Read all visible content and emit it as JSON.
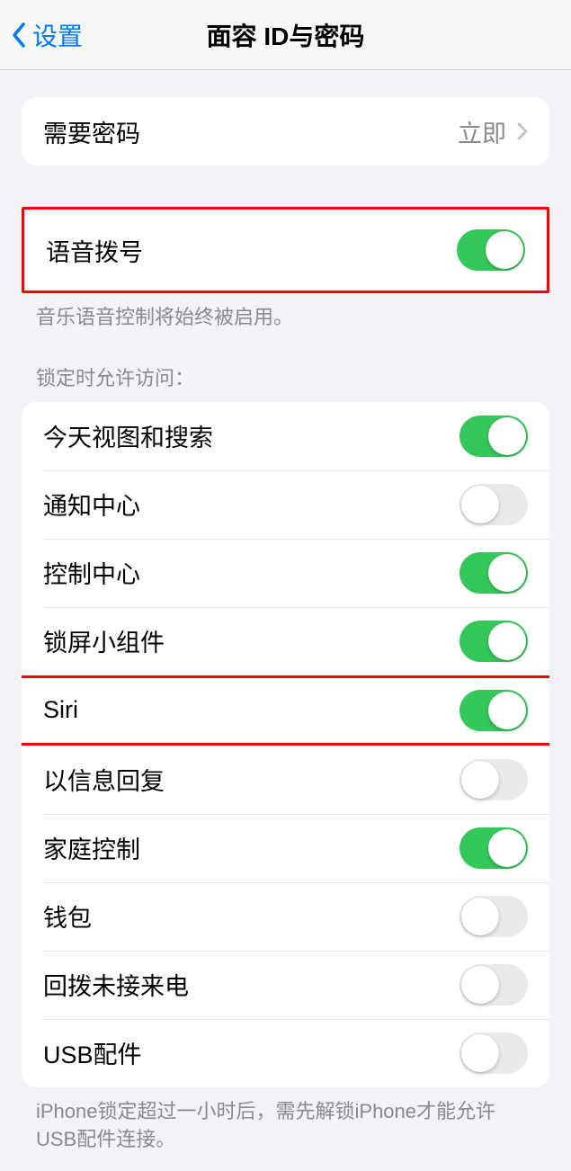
{
  "nav": {
    "back_label": "设置",
    "title": "面容 ID与密码"
  },
  "passcode_required": {
    "label": "需要密码",
    "value": "立即"
  },
  "voice_dial": {
    "label": "语音拨号",
    "on": true,
    "footer": "音乐语音控制将始终被启用。"
  },
  "locked_access": {
    "header": "锁定时允许访问：",
    "items": [
      {
        "label": "今天视图和搜索",
        "on": true
      },
      {
        "label": "通知中心",
        "on": false
      },
      {
        "label": "控制中心",
        "on": true
      },
      {
        "label": "锁屏小组件",
        "on": true
      },
      {
        "label": "Siri",
        "on": true
      },
      {
        "label": "以信息回复",
        "on": false
      },
      {
        "label": "家庭控制",
        "on": true
      },
      {
        "label": "钱包",
        "on": false
      },
      {
        "label": "回拨未接来电",
        "on": false
      },
      {
        "label": "USB配件",
        "on": false
      }
    ],
    "footer": "iPhone锁定超过一小时后，需先解锁iPhone才能允许USB配件连接。"
  }
}
